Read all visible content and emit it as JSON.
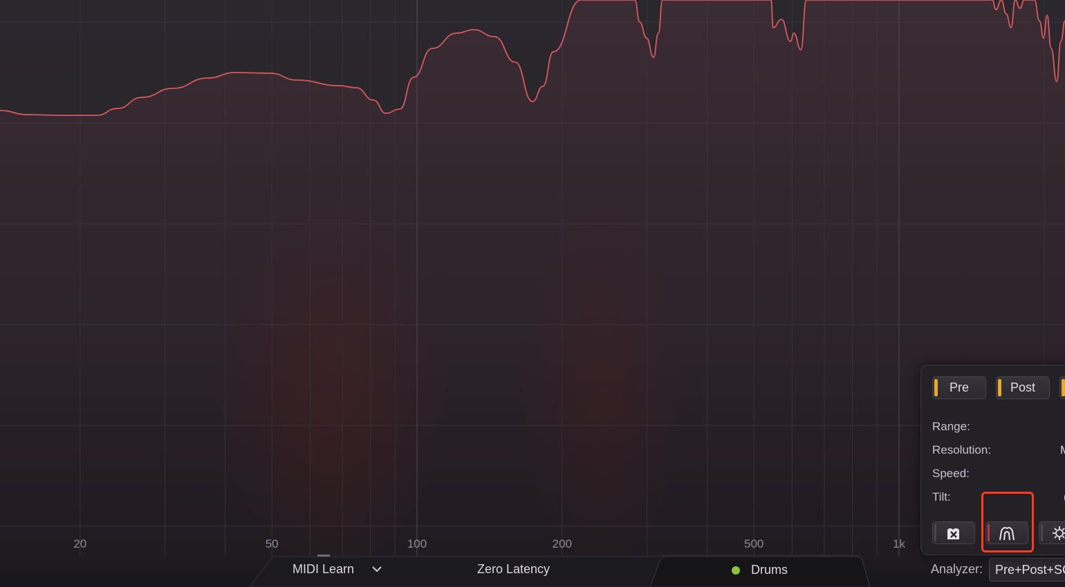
{
  "spectrum": {
    "frequency_labels": [
      {
        "text": "20",
        "hz": 20
      },
      {
        "text": "50",
        "hz": 50
      },
      {
        "text": "100",
        "hz": 100
      },
      {
        "text": "200",
        "hz": 200
      },
      {
        "text": "500",
        "hz": 500
      },
      {
        "text": "1k",
        "hz": 1000
      }
    ],
    "curve_color": "#d8595c",
    "background_color": "#2b272e"
  },
  "bottom_bar": {
    "midi_learn": "MIDI Learn",
    "zero_latency": "Zero Latency",
    "instance_name": "Drums",
    "instance_dot_color": "#8bc43a",
    "analyzer_label": "Analyzer:",
    "analyzer_value": "Pre+Post+SC"
  },
  "analyzer_panel": {
    "source_buttons": {
      "pre": "Pre",
      "post": "Post"
    },
    "source_led_color": "#e9a825",
    "labels": {
      "range": "Range:",
      "resolution": "Resolution:",
      "speed": "Speed:",
      "tilt": "Tilt:"
    },
    "resolution_value_peek": "M",
    "tilt_value_peek": "(",
    "mode_buttons": {
      "freeze": "freeze-icon",
      "peak_hold": "peak-hold-icon",
      "settings": "settings-icon"
    }
  },
  "highlight_color": "#ff3b22"
}
